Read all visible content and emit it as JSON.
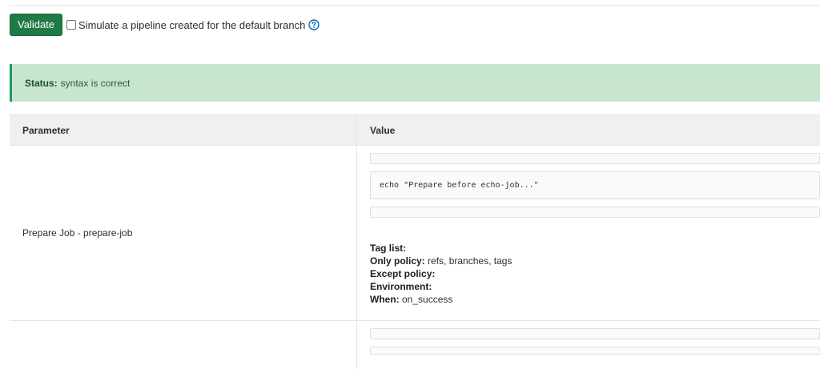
{
  "toolbar": {
    "validate_label": "Validate",
    "simulate_label": "Simulate a pipeline created for the default branch",
    "simulate_checked": false,
    "help_icon": "question-circle-icon"
  },
  "status": {
    "label": "Status:",
    "text": "syntax is correct"
  },
  "table": {
    "columns": [
      "Parameter",
      "Value"
    ],
    "rows": [
      {
        "parameter": "Prepare Job - prepare-job",
        "script": "echo \"Prepare before echo-job...\"",
        "tag_list_label": "Tag list:",
        "tag_list": "",
        "only_policy_label": "Only policy:",
        "only_policy": "refs, branches, tags",
        "except_policy_label": "Except policy:",
        "except_policy": "",
        "environment_label": "Environment:",
        "environment": "",
        "when_label": "When:",
        "when": "on_success"
      }
    ]
  },
  "colors": {
    "validate_bg": "#1f7a45",
    "status_bg": "#c8e6cf",
    "status_border": "#1f9c5b",
    "help_icon": "#1068bf"
  }
}
